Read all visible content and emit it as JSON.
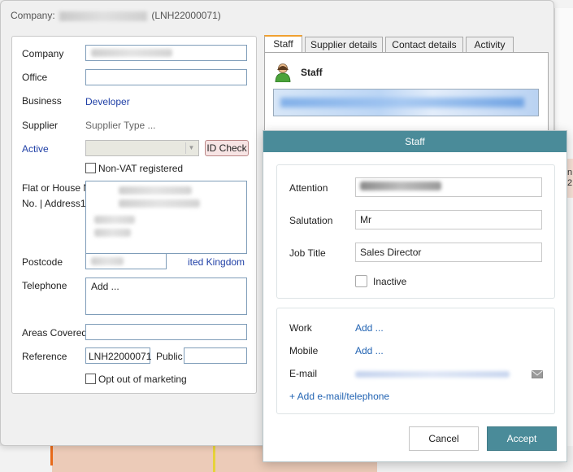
{
  "window": {
    "title_prefix": "Company:",
    "title_ref": "(LNH22000071)"
  },
  "form": {
    "company_label": "Company",
    "office_label": "Office",
    "business_label": "Business",
    "business_value": "Developer",
    "supplier_label": "Supplier",
    "supplier_value": "Supplier Type ...",
    "active_label": "Active",
    "id_check_label": "ID Check",
    "non_vat_label": "Non-VAT registered",
    "address_label_line1": "Flat or House Na",
    "address_label_line2": "No. | Address1",
    "postcode_label": "Postcode",
    "country_value": "ited Kingdom",
    "telephone_label": "Telephone",
    "telephone_value": "Add ...",
    "areas_label": "Areas Covered",
    "reference_label": "Reference",
    "reference_value": "LNH22000071",
    "public_label": "Public",
    "opt_out_label": "Opt out of marketing"
  },
  "tabs": [
    {
      "label": "Staff",
      "active": true
    },
    {
      "label": "Supplier details",
      "active": false
    },
    {
      "label": "Contact details",
      "active": false
    },
    {
      "label": "Activity",
      "active": false
    }
  ],
  "staff_panel": {
    "title": "Staff"
  },
  "modal": {
    "title": "Staff",
    "attention_label": "Attention",
    "salutation_label": "Salutation",
    "salutation_value": "Mr",
    "job_title_label": "Job Title",
    "job_title_value": "Sales Director",
    "inactive_label": "Inactive",
    "work_label": "Work",
    "work_value": "Add ...",
    "mobile_label": "Mobile",
    "mobile_value": "Add ...",
    "email_label": "E-mail",
    "add_email_label": "+ Add e-mail/telephone",
    "cancel_label": "Cancel",
    "accept_label": "Accept"
  },
  "background": {
    "right_text_line1": "n",
    "right_text_line2": "2"
  },
  "colors": {
    "accent_teal": "#4a8b99",
    "link_blue": "#1f3fa6",
    "tab_active_border": "#f0a030"
  }
}
